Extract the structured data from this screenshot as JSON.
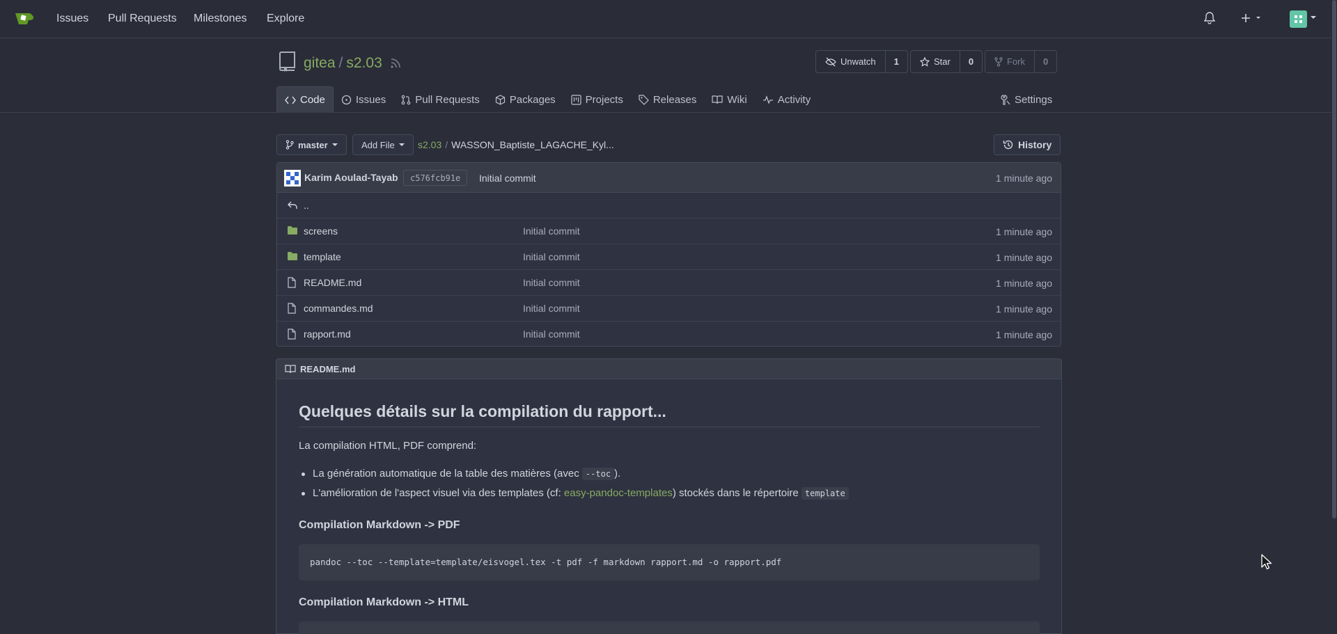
{
  "navbar": {
    "items": [
      "Issues",
      "Pull Requests",
      "Milestones",
      "Explore"
    ]
  },
  "repo": {
    "owner": "gitea",
    "separator": "/",
    "name": "s2.03",
    "unwatch_label": "Unwatch",
    "unwatch_count": "1",
    "star_label": "Star",
    "star_count": "0",
    "fork_label": "Fork",
    "fork_count": "0"
  },
  "tabs": [
    {
      "label": "Code",
      "icon": "code-icon"
    },
    {
      "label": "Issues",
      "icon": "issue-icon"
    },
    {
      "label": "Pull Requests",
      "icon": "pull-request-icon"
    },
    {
      "label": "Packages",
      "icon": "package-icon"
    },
    {
      "label": "Projects",
      "icon": "project-icon"
    },
    {
      "label": "Releases",
      "icon": "tag-icon"
    },
    {
      "label": "Wiki",
      "icon": "book-icon"
    },
    {
      "label": "Activity",
      "icon": "pulse-icon"
    }
  ],
  "settings_label": "Settings",
  "branch": {
    "name": "master",
    "add_file_label": "Add File",
    "history_label": "History"
  },
  "breadcrumb": {
    "repo": "s2.03",
    "sep": "/",
    "path": "WASSON_Baptiste_LAGACHE_Kyl..."
  },
  "commit": {
    "author": "Karim Aoulad-Tayab",
    "sha": "c576fcb91e",
    "message": "Initial commit",
    "time": "1 minute ago"
  },
  "parent_dir": "..",
  "files": [
    {
      "name": "screens",
      "type": "folder",
      "message": "Initial commit",
      "time": "1 minute ago"
    },
    {
      "name": "template",
      "type": "folder",
      "message": "Initial commit",
      "time": "1 minute ago"
    },
    {
      "name": "README.md",
      "type": "file",
      "message": "Initial commit",
      "time": "1 minute ago"
    },
    {
      "name": "commandes.md",
      "type": "file",
      "message": "Initial commit",
      "time": "1 minute ago"
    },
    {
      "name": "rapport.md",
      "type": "file",
      "message": "Initial commit",
      "time": "1 minute ago"
    }
  ],
  "readme": {
    "filename": "README.md",
    "h1": "Quelques détails sur la compilation du rapport...",
    "intro": "La compilation HTML, PDF comprend:",
    "li1_text": "La génération automatique de la table des matières (avec ",
    "li1_code": "--toc",
    "li1_end": ").",
    "li2_text": "L'amélioration de l'aspect visuel via des templates (cf: ",
    "li2_link": "easy-pandoc-templates",
    "li2_mid": ") stockés dans le répertoire ",
    "li2_code": "template",
    "h3_pdf": "Compilation Markdown -> PDF",
    "code_pdf": "pandoc --toc --template=template/eisvogel.tex -t pdf -f markdown rapport.md -o rapport.pdf",
    "h3_html": "Compilation Markdown -> HTML"
  }
}
